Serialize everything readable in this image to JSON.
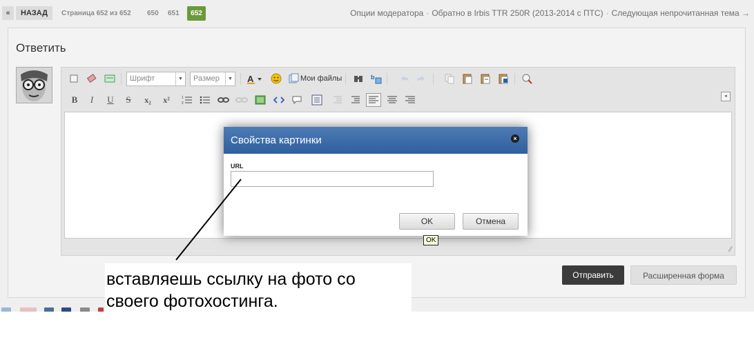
{
  "nav": {
    "arrow": "«",
    "back": "НАЗАД",
    "page_info": "Страница 652 из 652",
    "pages": [
      "650",
      "651"
    ],
    "current_page": "652"
  },
  "topright": {
    "moderator": "Опции модератора",
    "back_to": "Обратно в Irbis TTR 250R (2013-2014 с ПТС)",
    "next_unread": "Следующая непрочитанная тема →",
    "separator": "·"
  },
  "panel": {
    "title": "Ответить"
  },
  "toolbar": {
    "font_select": "Шрифт",
    "size_select": "Размер",
    "my_files": "Мои файлы",
    "bold": "B",
    "italic": "I",
    "underline": "U",
    "strike": "S",
    "subscript": "x₂",
    "superscript": "x²"
  },
  "buttons": {
    "send": "Отправить",
    "advanced": "Расширенная форма"
  },
  "dialog": {
    "title": "Свойства картинки",
    "url_label": "URL",
    "url_value": "",
    "ok": "OK",
    "cancel": "Отмена",
    "tooltip": "OK"
  },
  "annotation": {
    "text": "вставляешь ссылку на фото со\nсвоего фотохостинга."
  },
  "colors": {
    "accent_green": "#6a9a3a",
    "dialog_header": "#3a6aa8",
    "send_button": "#3b3b3b"
  }
}
